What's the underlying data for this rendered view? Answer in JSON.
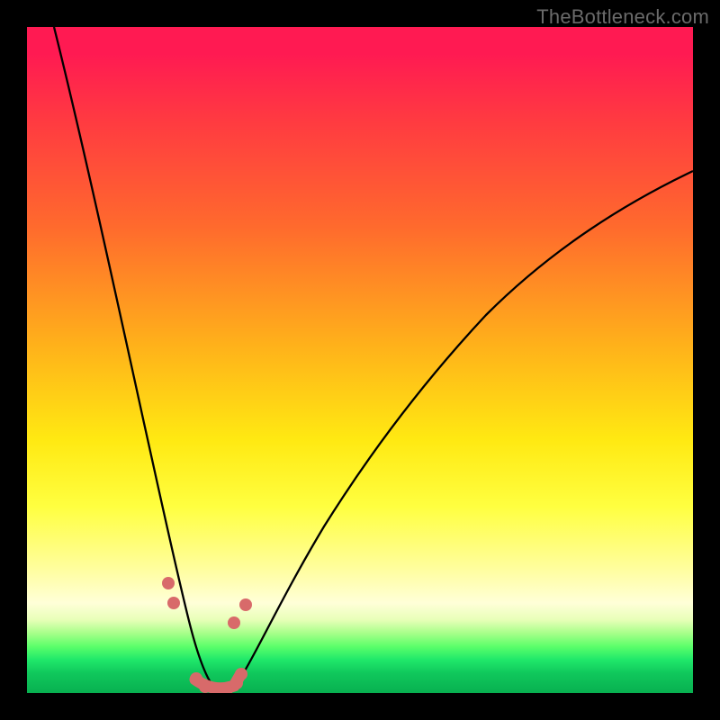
{
  "watermark": "TheBottleneck.com",
  "colors": {
    "background": "#000000",
    "curve": "#000000",
    "marker": "#d86a6a",
    "gradient_top": "#ff1a52",
    "gradient_mid": "#ffe912",
    "gradient_bottom": "#08b050"
  },
  "chart_data": {
    "type": "line",
    "title": "",
    "xlabel": "",
    "ylabel": "",
    "x_range_pct": [
      0,
      100
    ],
    "y_range_bottleneck_pct": [
      0,
      100
    ],
    "note": "Two V-shaped bottleneck curves meeting near x≈28%. y=100 at top (red, severe bottleneck), y=0 at bottom (green, no bottleneck). Values estimated from pixel positions.",
    "series": [
      {
        "name": "left-branch",
        "x_pct": [
          4,
          6,
          8,
          10,
          12,
          14,
          16,
          18,
          20,
          22,
          24,
          25,
          26,
          27,
          28,
          29
        ],
        "y_bottleneck_pct": [
          100,
          90,
          79,
          68,
          57,
          46,
          36,
          27,
          19,
          12,
          7,
          5,
          3,
          1.5,
          0.5,
          0
        ]
      },
      {
        "name": "right-branch",
        "x_pct": [
          29,
          30,
          32,
          35,
          40,
          45,
          50,
          55,
          60,
          65,
          70,
          75,
          80,
          85,
          90,
          95,
          100
        ],
        "y_bottleneck_pct": [
          0,
          1,
          4,
          9,
          18,
          27,
          35,
          42,
          48,
          54,
          59,
          64,
          68,
          71,
          74,
          76,
          78.5
        ]
      }
    ],
    "markers": {
      "name": "highlighted-points",
      "color": "#d86a6a",
      "points_xy_pct": [
        [
          21.2,
          16.5
        ],
        [
          22.0,
          13.5
        ],
        [
          25.3,
          2.0
        ],
        [
          26.5,
          1.0
        ],
        [
          28.0,
          0.3
        ],
        [
          29.5,
          0.3
        ],
        [
          31.0,
          1.0
        ],
        [
          32.0,
          2.7
        ],
        [
          31.0,
          10.5
        ],
        [
          32.7,
          13.3
        ]
      ]
    }
  }
}
